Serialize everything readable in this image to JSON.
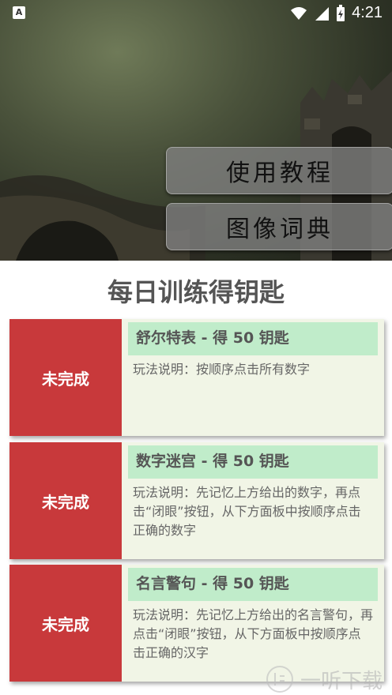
{
  "status_bar": {
    "time": "4:21",
    "left_icon": "A"
  },
  "hero": {
    "buttons": [
      {
        "label": "使用教程"
      },
      {
        "label": "图像词典"
      }
    ]
  },
  "page_title": "每日训练得钥匙",
  "tasks": [
    {
      "status": "未完成",
      "title": "舒尔特表 - 得 50 钥匙",
      "description": "玩法说明：按顺序点击所有数字"
    },
    {
      "status": "未完成",
      "title": "数字迷宫 - 得 50 钥匙",
      "description": "玩法说明：先记忆上方给出的数字，再点击“闭眼”按钮，从下方面板中按顺序点击正确的数字"
    },
    {
      "status": "未完成",
      "title": "名言警句 - 得 50 钥匙",
      "description": "玩法说明：先记忆上方给出的名言警句，再点击“闭眼”按钮，从下方面板中按顺序点击正确的汉字"
    }
  ],
  "watermark": "一听下载",
  "colors": {
    "status_red": "#c8393b",
    "header_green": "#c0ecca",
    "card_bg": "#f1f5e6"
  }
}
